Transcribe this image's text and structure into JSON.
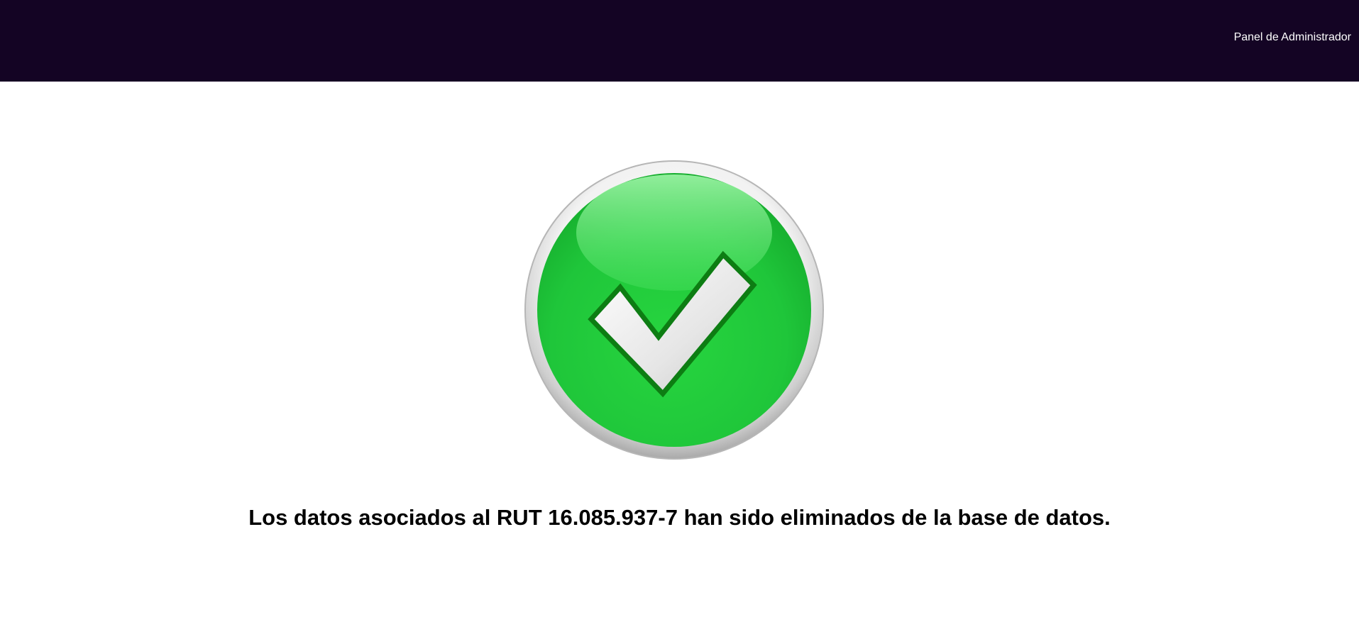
{
  "header": {
    "admin_link_label": "Panel de Administrador",
    "background_color": "#140424"
  },
  "main": {
    "status_icon": "check-circle-icon",
    "status_color": "#22cc33",
    "message": "Los datos asociados al RUT 16.085.937-7 han sido eliminados de la base de datos."
  }
}
